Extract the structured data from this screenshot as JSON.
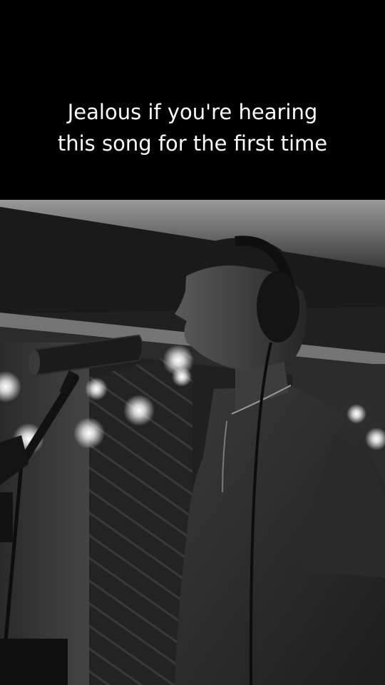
{
  "caption": {
    "text": "Jealous if you're hearing\nthis song for the first time"
  },
  "photo": {
    "scene": "black-and-white studio photo of a singer wearing headphones at a microphone"
  }
}
